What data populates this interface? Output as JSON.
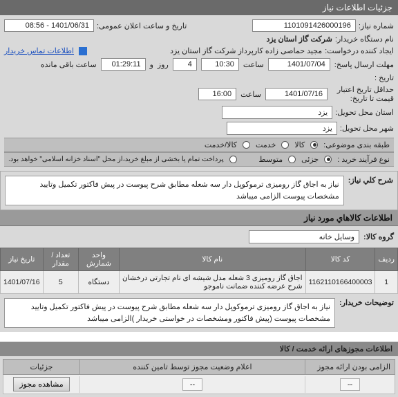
{
  "header": {
    "title": "جزئیات اطلاعات نیاز"
  },
  "fields": {
    "need_no_label": "شماره نیاز:",
    "need_no": "1101091426000196",
    "announce_label": "تاریخ و ساعت اعلان عمومی:",
    "announce_val": "1401/06/31 - 08:56",
    "buyer_org_label": "نام دستگاه خریدار:",
    "buyer_org": "شرکت گاز استان یزد",
    "creator_label": "ایجاد کننده درخواست:",
    "creator": "مجید حماصی زاده کارپرداز شرکت گاز استان یزد",
    "contact_link": "اطلاعات تماس خریدار",
    "send_deadline_label": "مهلت ارسال پاسخ:",
    "send_deadline_date": "1401/07/04",
    "time_label": "ساعت",
    "send_deadline_time": "10:30",
    "day_label": "روز",
    "days": "4",
    "and_label": "و",
    "remain_time": "01:29:11",
    "remain_label": "ساعت باقی مانده",
    "history_label": "تاریخ :",
    "min_valid_label": "حداقل تاریخ اعتبار قیمت تا تاریخ:",
    "min_valid_date": "1401/07/16",
    "min_valid_time": "16:00",
    "deliver_loc_label": "استان محل تحویل:",
    "deliver_loc": "یزد",
    "deliver_city_label": "شهر محل تحویل:",
    "deliver_city": "یزد",
    "cat_label": "طبقه بندی موضوعی:",
    "goods_opt": "کالا",
    "service_opt": "خدمت",
    "goods_service_opt": "کالا/خدمت",
    "purchase_type_label": "نوع فرآیند خرید :",
    "partial_opt": "جزئی",
    "medium_opt": "متوسط",
    "pay_note": "پرداخت تمام یا بخشی از مبلغ خرید،از محل \"اسناد خزانه اسلامی\" خواهد بود.",
    "desc_label": "شرح کلي نیاز:",
    "desc_text": "نیاز به اجاق گاز رومیزی ترموکوپل دار سه شعله مطابق شرح پیوست در پیش فاکتور تکمیل وتایید مشخصات پیوست الزامی میباشد"
  },
  "goods_section": {
    "title": "اطلاعات کالاهاي مورد نیاز",
    "group_label": "گروه کالا:",
    "group_value": "وسایل خانه"
  },
  "table": {
    "headers": [
      "ردیف",
      "کد کالا",
      "نام کالا",
      "واحد شمارش",
      "تعداد / مقدار",
      "تاریخ نیاز"
    ],
    "rows": [
      {
        "idx": "1",
        "code": "1162110166400003",
        "name": "اجاق گاز رومیزی 3 شعله مدل شیشه ای نام تجارتی درخشان شرح عرضه کننده ضمانت ناموجو",
        "unit": "دستگاه",
        "qty": "5",
        "date": "1401/07/16"
      }
    ]
  },
  "buyer_note": {
    "label": "توضیحات خریدار:",
    "text": "نیاز به اجاق گاز رومیزی ترموکوپل دار سه شعله مطابق شرح پیوست در پیش فاکتور تکمیل وتایید مشخصات پیوست (پیش فاکتور ومشخصات در خواستی خریدار )الزامی میباشد"
  },
  "footer": {
    "title": "اطلاعات مجوزهای ارائه خدمت / کالا",
    "permit_required_label": "الزامی بودن ارائه مجوز",
    "status_label": "اعلام وضعیت مجوز توسط تامین کننده",
    "details_label": "جزئیات",
    "dash": "--",
    "view_btn": "مشاهده مجوز"
  }
}
